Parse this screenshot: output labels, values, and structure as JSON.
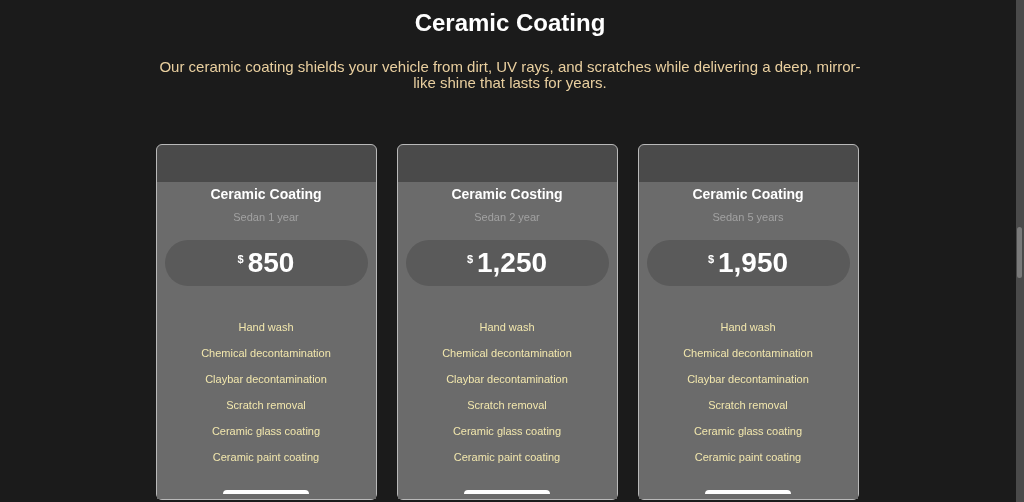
{
  "title": "Ceramic Coating",
  "description": "Our ceramic coating shields your vehicle from dirt, UV rays, and scratches while delivering a deep, mirror-like shine that lasts for years.",
  "plans": [
    {
      "name": "Ceramic Coating",
      "subtitle": "Sedan 1 year",
      "currency": "$",
      "price": "850",
      "features": [
        "Hand wash",
        "Chemical decontamination",
        "Claybar decontamination",
        "Scratch removal",
        "Ceramic glass coating",
        "Ceramic paint coating"
      ]
    },
    {
      "name": "Ceramic Costing",
      "subtitle": "Sedan 2 year",
      "currency": "$",
      "price": "1,250",
      "features": [
        "Hand wash",
        "Chemical decontamination",
        "Claybar decontamination",
        "Scratch removal",
        "Ceramic glass coating",
        "Ceramic paint coating"
      ]
    },
    {
      "name": "Ceramic Coating",
      "subtitle": "Sedan 5 years",
      "currency": "$",
      "price": "1,950",
      "features": [
        "Hand wash",
        "Chemical decontamination",
        "Claybar decontamination",
        "Scratch removal",
        "Ceramic glass coating",
        "Ceramic paint coating"
      ]
    }
  ]
}
